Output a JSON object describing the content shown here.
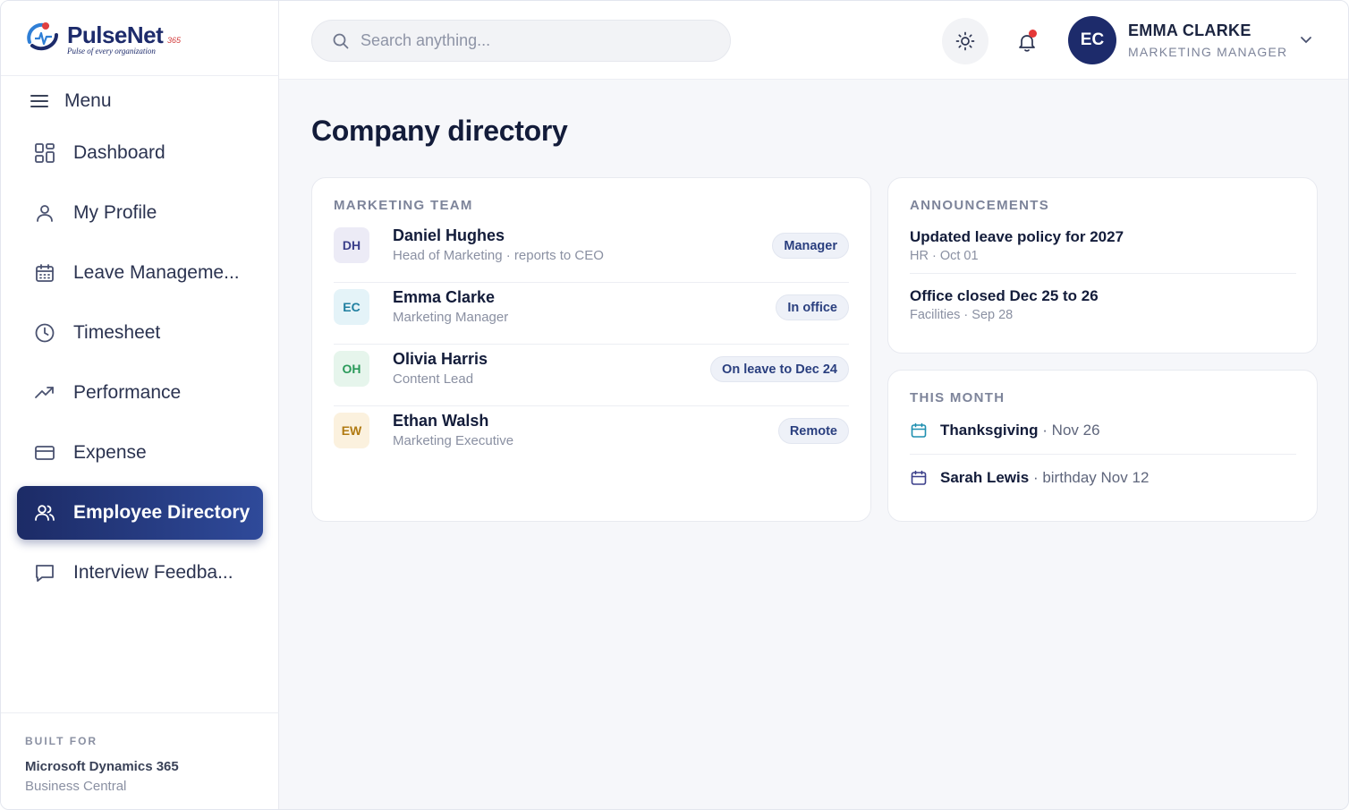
{
  "brand": {
    "name": "PulseNet",
    "superscript": "365",
    "tagline": "Pulse of every organization"
  },
  "sidebar": {
    "menu_label": "Menu",
    "items": [
      {
        "label": "Dashboard",
        "icon": "dashboard-icon"
      },
      {
        "label": "My Profile",
        "icon": "user-icon"
      },
      {
        "label": "Leave Manageme...",
        "icon": "calendar-icon"
      },
      {
        "label": "Timesheet",
        "icon": "clock-icon"
      },
      {
        "label": "Performance",
        "icon": "trending-up-icon"
      },
      {
        "label": "Expense",
        "icon": "credit-card-icon"
      },
      {
        "label": "Employee Directory",
        "icon": "users-icon",
        "active": true
      },
      {
        "label": "Interview Feedba...",
        "icon": "chat-icon"
      }
    ],
    "built_for": {
      "label": "BUILT FOR",
      "line1": "Microsoft Dynamics 365",
      "line2": "Business Central"
    }
  },
  "topbar": {
    "search_placeholder": "Search anything...",
    "user": {
      "initials": "EC",
      "name": "EMMA CLARKE",
      "role": "MARKETING MANAGER"
    }
  },
  "main": {
    "title": "Company directory",
    "team": {
      "label": "MARKETING TEAM",
      "members": [
        {
          "initials": "DH",
          "name": "Daniel Hughes",
          "role": "Head of Marketing · reports to CEO",
          "badge": "Manager",
          "avatar_bg": "#ecebf6",
          "avatar_fg": "#3b3f8a"
        },
        {
          "initials": "EC",
          "name": "Emma Clarke",
          "role": "Marketing Manager",
          "badge": "In office",
          "avatar_bg": "#e4f3f8",
          "avatar_fg": "#1f7fa0"
        },
        {
          "initials": "OH",
          "name": "Olivia Harris",
          "role": "Content Lead",
          "badge": "On leave to Dec 24",
          "avatar_bg": "#e6f5ec",
          "avatar_fg": "#2a9a5a"
        },
        {
          "initials": "EW",
          "name": "Ethan Walsh",
          "role": "Marketing Executive",
          "badge": "Remote",
          "avatar_bg": "#fbf1de",
          "avatar_fg": "#b07a12"
        }
      ]
    },
    "announcements": {
      "label": "ANNOUNCEMENTS",
      "items": [
        {
          "title": "Updated leave policy for 2027",
          "meta": "HR · Oct 01"
        },
        {
          "title": "Office closed Dec 25 to 26",
          "meta": "Facilities · Sep 28"
        }
      ]
    },
    "this_month": {
      "label": "THIS MONTH",
      "events": [
        {
          "name": "Thanksgiving",
          "detail": " · Nov 26",
          "icon_color": "#1f8fb0"
        },
        {
          "name": "Sarah Lewis",
          "detail": " · birthday Nov 12",
          "icon_color": "#3b3f8a"
        }
      ]
    }
  },
  "colors": {
    "brand_navy": "#1d2b6b",
    "active_gradient_end": "#2f4a9a",
    "notification_dot": "#e53838"
  }
}
